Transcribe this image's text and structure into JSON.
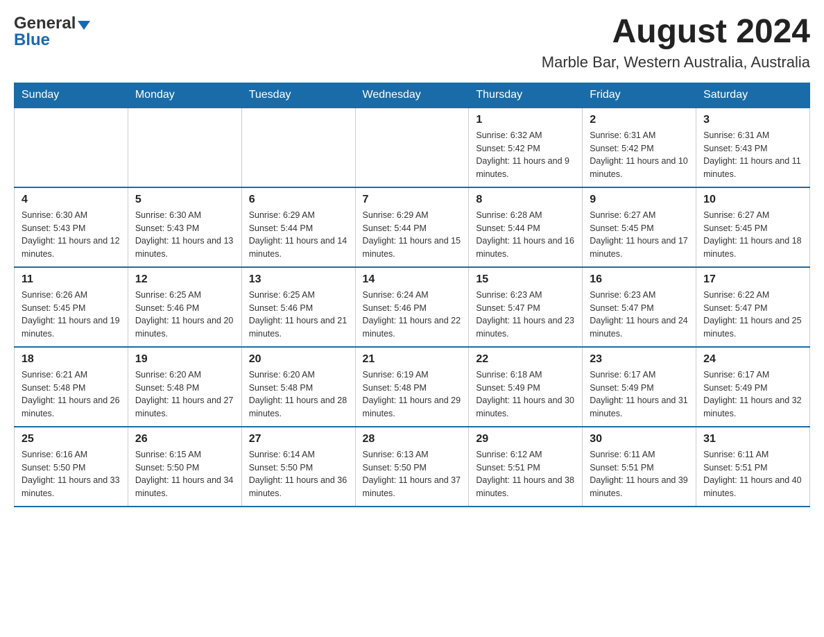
{
  "header": {
    "logo": {
      "general": "General",
      "arrow": "▲",
      "blue": "Blue"
    },
    "month_title": "August 2024",
    "location": "Marble Bar, Western Australia, Australia"
  },
  "days_of_week": [
    "Sunday",
    "Monday",
    "Tuesday",
    "Wednesday",
    "Thursday",
    "Friday",
    "Saturday"
  ],
  "weeks": [
    {
      "days": [
        {
          "number": "",
          "info": ""
        },
        {
          "number": "",
          "info": ""
        },
        {
          "number": "",
          "info": ""
        },
        {
          "number": "",
          "info": ""
        },
        {
          "number": "1",
          "info": "Sunrise: 6:32 AM\nSunset: 5:42 PM\nDaylight: 11 hours and 9 minutes."
        },
        {
          "number": "2",
          "info": "Sunrise: 6:31 AM\nSunset: 5:42 PM\nDaylight: 11 hours and 10 minutes."
        },
        {
          "number": "3",
          "info": "Sunrise: 6:31 AM\nSunset: 5:43 PM\nDaylight: 11 hours and 11 minutes."
        }
      ]
    },
    {
      "days": [
        {
          "number": "4",
          "info": "Sunrise: 6:30 AM\nSunset: 5:43 PM\nDaylight: 11 hours and 12 minutes."
        },
        {
          "number": "5",
          "info": "Sunrise: 6:30 AM\nSunset: 5:43 PM\nDaylight: 11 hours and 13 minutes."
        },
        {
          "number": "6",
          "info": "Sunrise: 6:29 AM\nSunset: 5:44 PM\nDaylight: 11 hours and 14 minutes."
        },
        {
          "number": "7",
          "info": "Sunrise: 6:29 AM\nSunset: 5:44 PM\nDaylight: 11 hours and 15 minutes."
        },
        {
          "number": "8",
          "info": "Sunrise: 6:28 AM\nSunset: 5:44 PM\nDaylight: 11 hours and 16 minutes."
        },
        {
          "number": "9",
          "info": "Sunrise: 6:27 AM\nSunset: 5:45 PM\nDaylight: 11 hours and 17 minutes."
        },
        {
          "number": "10",
          "info": "Sunrise: 6:27 AM\nSunset: 5:45 PM\nDaylight: 11 hours and 18 minutes."
        }
      ]
    },
    {
      "days": [
        {
          "number": "11",
          "info": "Sunrise: 6:26 AM\nSunset: 5:45 PM\nDaylight: 11 hours and 19 minutes."
        },
        {
          "number": "12",
          "info": "Sunrise: 6:25 AM\nSunset: 5:46 PM\nDaylight: 11 hours and 20 minutes."
        },
        {
          "number": "13",
          "info": "Sunrise: 6:25 AM\nSunset: 5:46 PM\nDaylight: 11 hours and 21 minutes."
        },
        {
          "number": "14",
          "info": "Sunrise: 6:24 AM\nSunset: 5:46 PM\nDaylight: 11 hours and 22 minutes."
        },
        {
          "number": "15",
          "info": "Sunrise: 6:23 AM\nSunset: 5:47 PM\nDaylight: 11 hours and 23 minutes."
        },
        {
          "number": "16",
          "info": "Sunrise: 6:23 AM\nSunset: 5:47 PM\nDaylight: 11 hours and 24 minutes."
        },
        {
          "number": "17",
          "info": "Sunrise: 6:22 AM\nSunset: 5:47 PM\nDaylight: 11 hours and 25 minutes."
        }
      ]
    },
    {
      "days": [
        {
          "number": "18",
          "info": "Sunrise: 6:21 AM\nSunset: 5:48 PM\nDaylight: 11 hours and 26 minutes."
        },
        {
          "number": "19",
          "info": "Sunrise: 6:20 AM\nSunset: 5:48 PM\nDaylight: 11 hours and 27 minutes."
        },
        {
          "number": "20",
          "info": "Sunrise: 6:20 AM\nSunset: 5:48 PM\nDaylight: 11 hours and 28 minutes."
        },
        {
          "number": "21",
          "info": "Sunrise: 6:19 AM\nSunset: 5:48 PM\nDaylight: 11 hours and 29 minutes."
        },
        {
          "number": "22",
          "info": "Sunrise: 6:18 AM\nSunset: 5:49 PM\nDaylight: 11 hours and 30 minutes."
        },
        {
          "number": "23",
          "info": "Sunrise: 6:17 AM\nSunset: 5:49 PM\nDaylight: 11 hours and 31 minutes."
        },
        {
          "number": "24",
          "info": "Sunrise: 6:17 AM\nSunset: 5:49 PM\nDaylight: 11 hours and 32 minutes."
        }
      ]
    },
    {
      "days": [
        {
          "number": "25",
          "info": "Sunrise: 6:16 AM\nSunset: 5:50 PM\nDaylight: 11 hours and 33 minutes."
        },
        {
          "number": "26",
          "info": "Sunrise: 6:15 AM\nSunset: 5:50 PM\nDaylight: 11 hours and 34 minutes."
        },
        {
          "number": "27",
          "info": "Sunrise: 6:14 AM\nSunset: 5:50 PM\nDaylight: 11 hours and 36 minutes."
        },
        {
          "number": "28",
          "info": "Sunrise: 6:13 AM\nSunset: 5:50 PM\nDaylight: 11 hours and 37 minutes."
        },
        {
          "number": "29",
          "info": "Sunrise: 6:12 AM\nSunset: 5:51 PM\nDaylight: 11 hours and 38 minutes."
        },
        {
          "number": "30",
          "info": "Sunrise: 6:11 AM\nSunset: 5:51 PM\nDaylight: 11 hours and 39 minutes."
        },
        {
          "number": "31",
          "info": "Sunrise: 6:11 AM\nSunset: 5:51 PM\nDaylight: 11 hours and 40 minutes."
        }
      ]
    }
  ]
}
